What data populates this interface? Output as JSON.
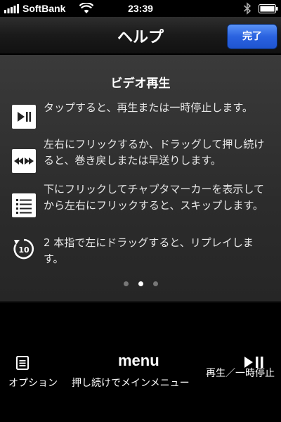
{
  "status_bar": {
    "carrier": "SoftBank",
    "time": "23:39"
  },
  "navbar": {
    "title": "ヘルプ",
    "done_label": "完了"
  },
  "help": {
    "section_title": "ビデオ再生",
    "items": [
      {
        "icon": "play-pause-icon",
        "text": "タップすると、再生または一時停止します。"
      },
      {
        "icon": "rewind-fastforward-icon",
        "text": "左右にフリックするか、ドラッグして押し続けると、巻き戻しまたは早送りします。"
      },
      {
        "icon": "chapter-list-icon",
        "text": "下にフリックしてチャプタマーカーを表示してから左右にフリックすると、スキップします。"
      },
      {
        "icon": "replay-10-icon",
        "icon_text": "10",
        "text": "2 本指で左にドラッグすると、リプレイします。"
      }
    ],
    "page_indicator": {
      "count": 3,
      "active_index": 1
    }
  },
  "bottom_controls": {
    "options_label": "オプション",
    "menu_word": "menu",
    "menu_label": "押し続けでメインメニュー",
    "play_label": "再生／一時停止"
  },
  "colors": {
    "done_button": "#2a62e0",
    "panel_background": "#2c2c2c"
  }
}
